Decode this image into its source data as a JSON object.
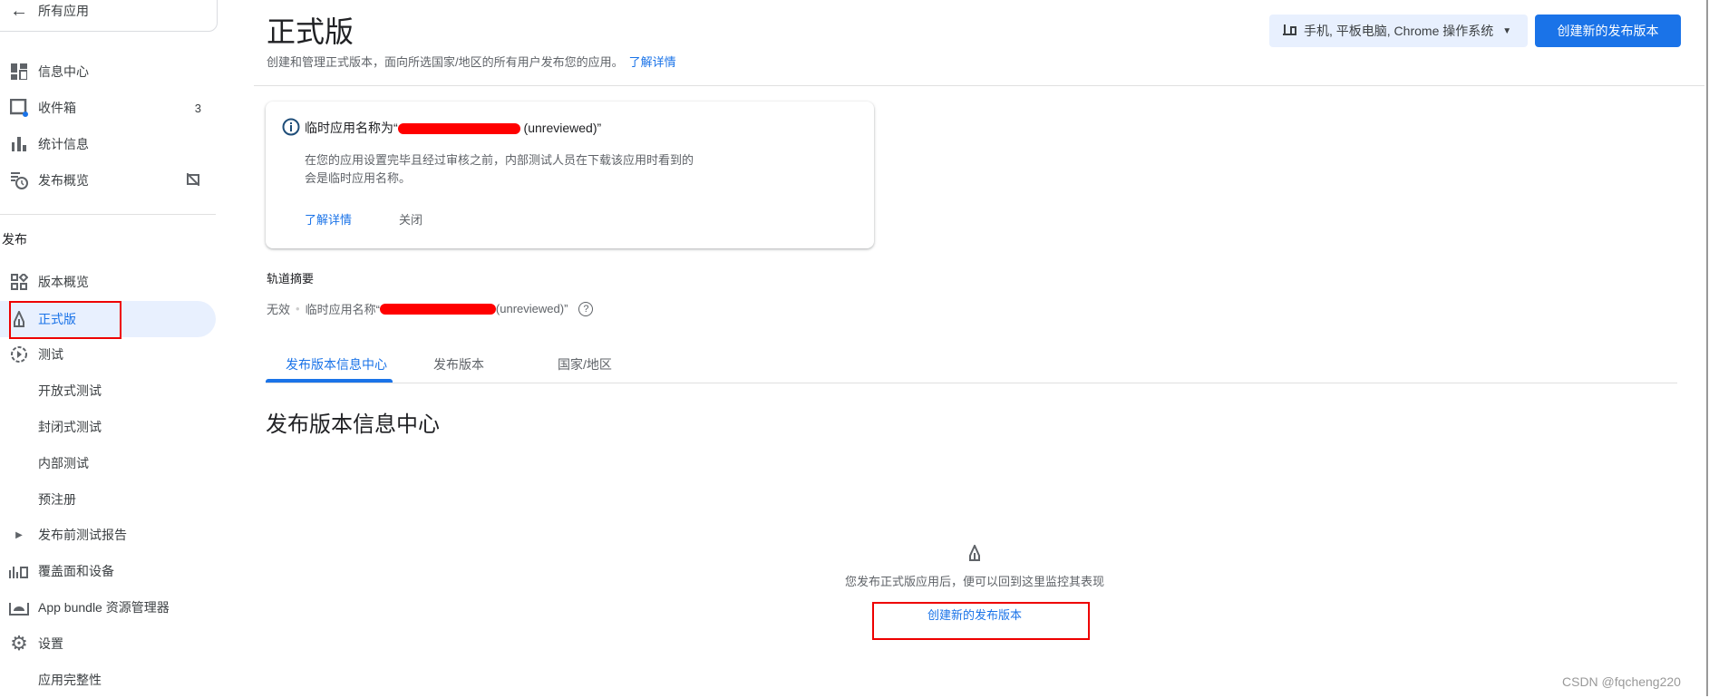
{
  "sidebar": {
    "back_label": "所有应用",
    "items": [
      {
        "label": "信息中心",
        "icon": "dashboard-icon"
      },
      {
        "label": "收件箱",
        "icon": "inbox-icon",
        "badge": "3"
      },
      {
        "label": "统计信息",
        "icon": "bar-chart-icon"
      },
      {
        "label": "发布概览",
        "icon": "publishing-overview-icon"
      }
    ],
    "section_label": "发布",
    "release_items": [
      {
        "label": "版本概览",
        "icon": "releases-overview-icon"
      },
      {
        "label": "正式版",
        "icon": "production-icon",
        "active": true
      },
      {
        "label": "测试",
        "icon": "testing-icon"
      },
      {
        "label": "开放式测试"
      },
      {
        "label": "封闭式测试"
      },
      {
        "label": "内部测试"
      },
      {
        "label": "预注册"
      },
      {
        "label": "发布前测试报告",
        "icon": "expand-arrow-icon"
      },
      {
        "label": "覆盖面和设备",
        "icon": "reach-devices-icon"
      },
      {
        "label": "App bundle 资源管理器",
        "icon": "android-icon"
      },
      {
        "label": "设置",
        "icon": "gear-icon"
      },
      {
        "label": "应用完整性"
      }
    ]
  },
  "header": {
    "title": "正式版",
    "subtitle": "创建和管理正式版本，面向所选国家/地区的所有用户发布您的应用。",
    "learn_more": "了解详情",
    "device_filter": "手机, 平板电脑, Chrome 操作系统",
    "create_release": "创建新的发布版本"
  },
  "notice": {
    "title_prefix": "临时应用名称为“",
    "title_suffix": " (unreviewed)”",
    "body": "在您的应用设置完毕且经过审核之前，内部测试人员在下载该应用时看到的会是临时应用名称。",
    "learn_more": "了解详情",
    "close": "关闭"
  },
  "track_summary": {
    "heading": "轨道摘要",
    "status": "无效",
    "name_prefix": "临时应用名称“",
    "name_suffix": " (unreviewed)”"
  },
  "tabs": [
    "发布版本信息中心",
    "发布版本",
    "国家/地区"
  ],
  "section": {
    "heading": "发布版本信息中心",
    "empty_text": "您发布正式版应用后，便可以回到这里监控其表现",
    "empty_link": "创建新的发布版本"
  },
  "watermark": "CSDN @fqcheng220",
  "colors": {
    "accent": "#1a73e8",
    "annotation": "#ee0000"
  }
}
